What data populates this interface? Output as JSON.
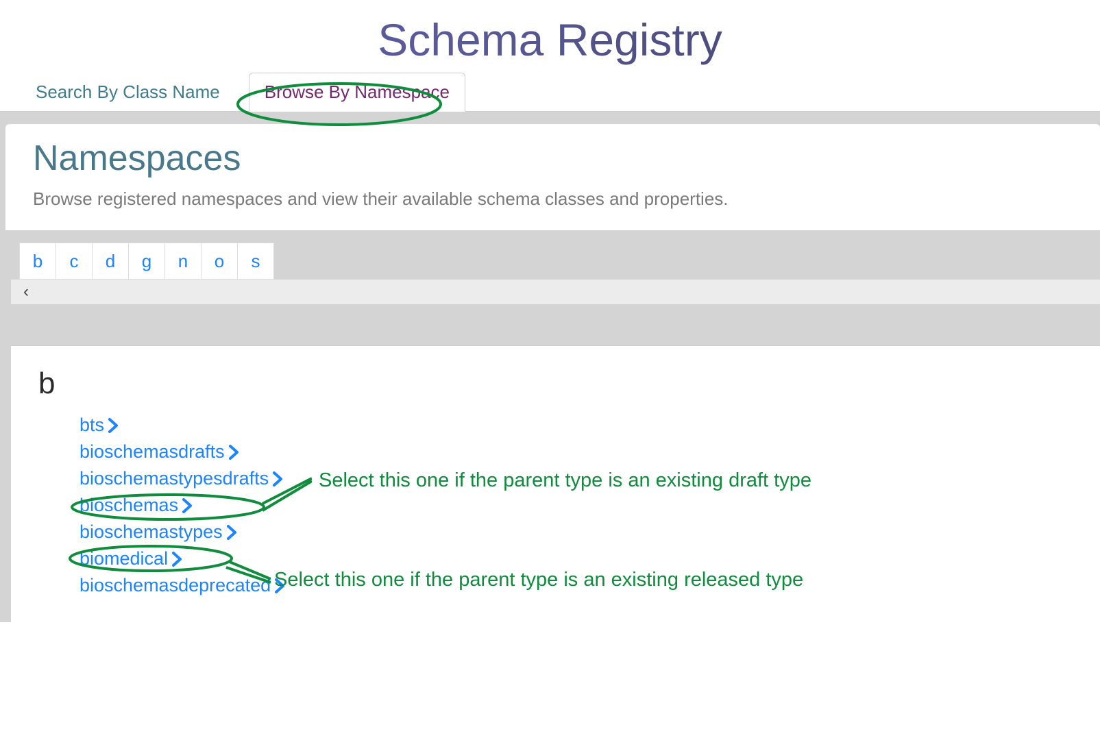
{
  "header": {
    "title": "Schema Registry"
  },
  "tabs": {
    "search": "Search By Class Name",
    "browse": "Browse By Namespace"
  },
  "section": {
    "title": "Namespaces",
    "desc": "Browse registered namespaces and view their available schema classes and properties."
  },
  "alpha": [
    "b",
    "c",
    "d",
    "g",
    "n",
    "o",
    "s"
  ],
  "pager": {
    "prev": "‹"
  },
  "letter": "b",
  "namespaces": [
    "bts",
    "bioschemasdrafts",
    "bioschemastypesdrafts",
    "bioschemas",
    "bioschemastypes",
    "biomedical",
    "bioschemasdeprecated"
  ],
  "annotations": {
    "draft": "Select this one if the parent type is an existing draft type",
    "released": "Select this one if the parent type is an existing released type"
  },
  "colors": {
    "link": "#1b84ff",
    "teal": "#48788a",
    "purple": "#742a6e",
    "annot": "#0f8c3c"
  }
}
